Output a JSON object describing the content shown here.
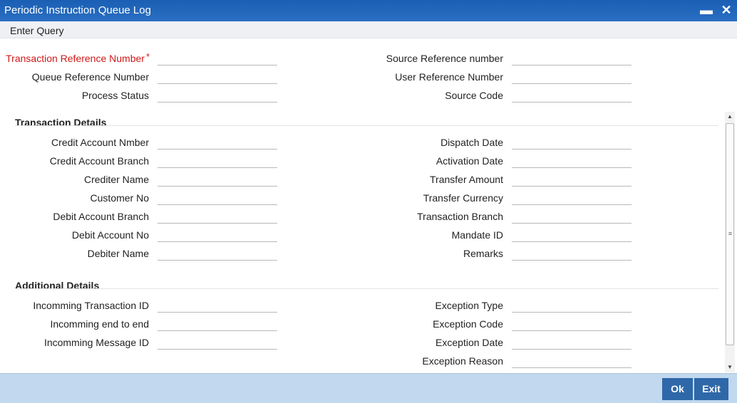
{
  "window": {
    "title": "Periodic Instruction Queue Log",
    "minimize_glyph": "▬",
    "close_glyph": "✕"
  },
  "menu": {
    "enter_query": "Enter Query"
  },
  "header_fields": {
    "left": [
      {
        "label": "Transaction Reference Number",
        "required": true,
        "value": ""
      },
      {
        "label": "Queue Reference Number",
        "value": ""
      },
      {
        "label": "Process Status",
        "value": ""
      }
    ],
    "right": [
      {
        "label": "Source Reference number",
        "value": ""
      },
      {
        "label": "User Reference Number",
        "value": ""
      },
      {
        "label": "Source Code",
        "value": ""
      }
    ]
  },
  "transaction_details": {
    "title": "Transaction Details",
    "left": [
      {
        "label": "Credit Account Nmber",
        "value": ""
      },
      {
        "label": "Credit Account Branch",
        "value": ""
      },
      {
        "label": "Crediter Name",
        "value": ""
      },
      {
        "label": "Customer No",
        "value": ""
      },
      {
        "label": "Debit Account Branch",
        "value": ""
      },
      {
        "label": "Debit Account No",
        "value": ""
      },
      {
        "label": "Debiter Name",
        "value": ""
      }
    ],
    "right": [
      {
        "label": "Dispatch Date",
        "value": ""
      },
      {
        "label": "Activation Date",
        "value": ""
      },
      {
        "label": "Transfer Amount",
        "value": ""
      },
      {
        "label": "Transfer Currency",
        "value": ""
      },
      {
        "label": "Transaction Branch",
        "value": ""
      },
      {
        "label": "Mandate ID",
        "value": ""
      },
      {
        "label": "Remarks",
        "value": ""
      }
    ]
  },
  "additional_details": {
    "title": "Additional Details",
    "left": [
      {
        "label": "Incomming Transaction ID",
        "value": ""
      },
      {
        "label": "Incomming end to end",
        "value": ""
      },
      {
        "label": "Incomming Message ID",
        "value": ""
      }
    ],
    "right": [
      {
        "label": "Exception Type",
        "value": ""
      },
      {
        "label": "Exception Code",
        "value": ""
      },
      {
        "label": "Exception Date",
        "value": ""
      },
      {
        "label": "Exception Reason",
        "value": ""
      }
    ]
  },
  "required_marker": "*",
  "scrollbar": {
    "up_glyph": "▲",
    "down_glyph": "▼",
    "grip_glyph": "≡"
  },
  "footer": {
    "ok_label": "Ok",
    "exit_label": "Exit"
  },
  "colors": {
    "titlebar": "#1a5fb4",
    "required_label": "#d01818",
    "footer_bg": "#c1d8ee",
    "button_bg": "#2f68a8"
  }
}
